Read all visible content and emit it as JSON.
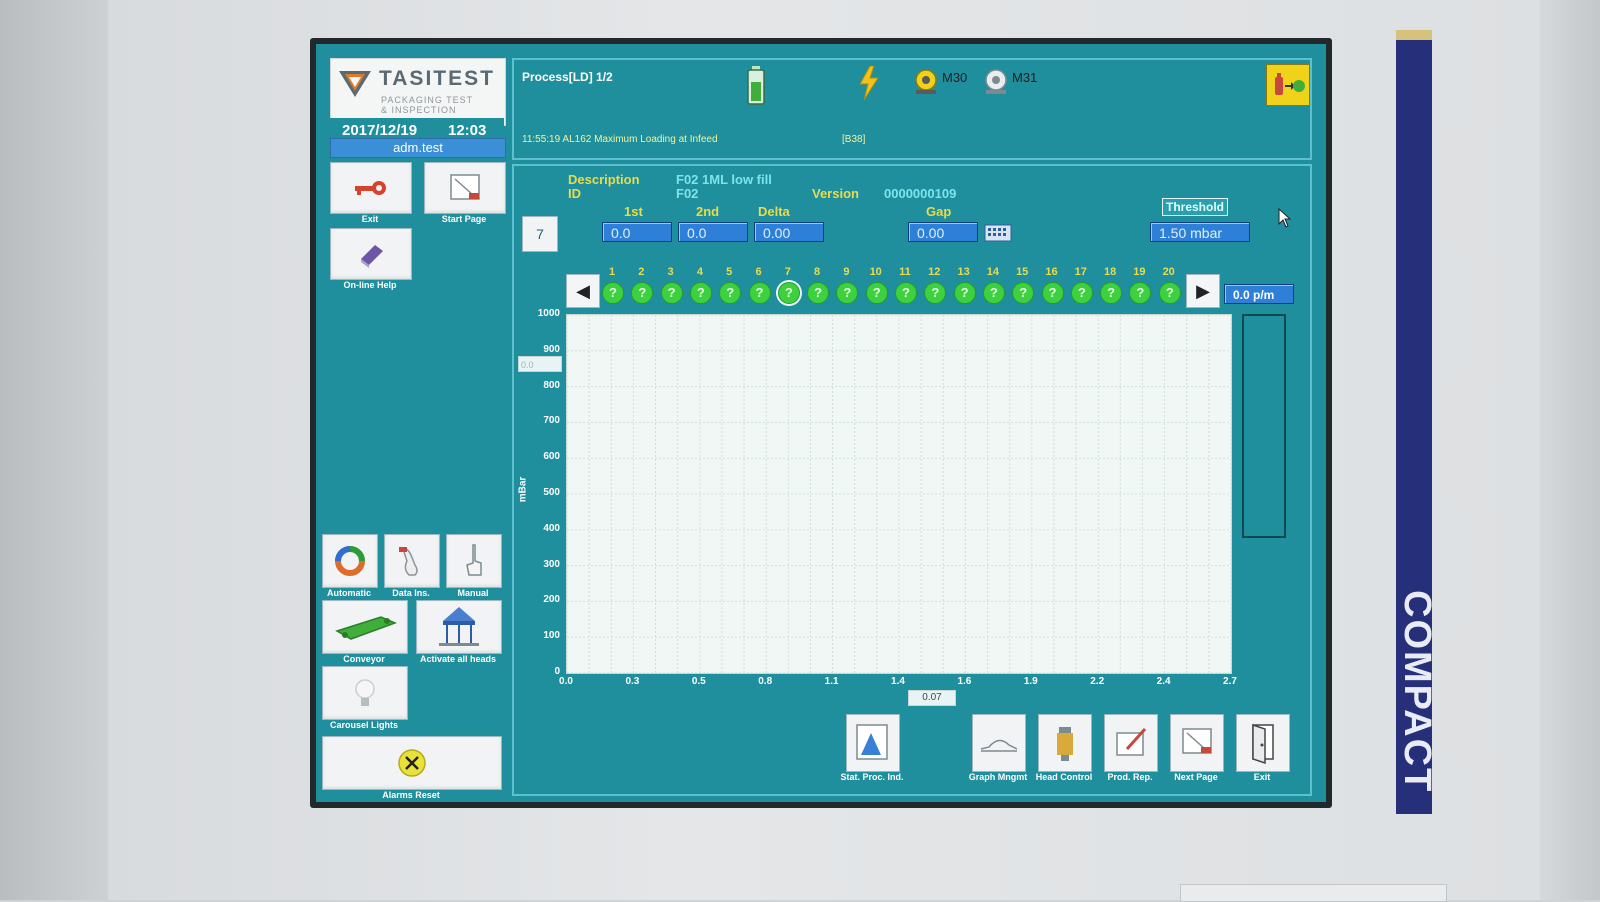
{
  "branding": {
    "logo_name": "TASITEST",
    "logo_sub_line1": "PACKAGING TEST",
    "logo_sub_line2": "& INSPECTION",
    "panel_brand": "COMPACT"
  },
  "session": {
    "date": "2017/12/19",
    "time": "12:03",
    "user": "adm.test"
  },
  "left_toolbar": {
    "exit": "Exit",
    "start_page": "Start Page",
    "online_help": "On-line Help",
    "automatic": "Automatic",
    "data_ins": "Data Ins.",
    "manual": "Manual",
    "conveyor": "Conveyor",
    "activate_all_heads": "Activate all heads",
    "carousel_lights": "Carousel Lights",
    "alarms_reset": "Alarms Reset"
  },
  "header": {
    "process": "Process[LD] 1/2",
    "m30": "M30",
    "m31": "M31",
    "alarm_message": "11:55:19 AL162 Maximum Loading at Infeed",
    "alarm_code": "[B38]"
  },
  "recipe": {
    "description_label": "Description",
    "description_value": "F02 1ML low fill",
    "id_label": "ID",
    "id_value": "F02",
    "version_label": "Version",
    "version_value": "0000000109"
  },
  "measures": {
    "head_selected": "7",
    "first_label": "1st",
    "first_value": "0.0",
    "second_label": "2nd",
    "second_value": "0.0",
    "delta_label": "Delta",
    "delta_value": "0.00",
    "gap_label": "Gap",
    "gap_value": "0.00",
    "threshold_label": "Threshold",
    "threshold_value": "1.50 mbar",
    "speed_value": "0.0 p/m"
  },
  "heads": {
    "selected": 7,
    "status_glyph": "?",
    "numbers": [
      "1",
      "2",
      "3",
      "4",
      "5",
      "6",
      "7",
      "8",
      "9",
      "10",
      "11",
      "12",
      "13",
      "14",
      "15",
      "16",
      "17",
      "18",
      "19",
      "20"
    ]
  },
  "chart_data": {
    "type": "line",
    "ylabel": "mBar",
    "ylim": [
      0,
      1000
    ],
    "y_ticks": [
      "0",
      "100",
      "200",
      "300",
      "400",
      "500",
      "600",
      "700",
      "800",
      "900",
      "1000"
    ],
    "x_ticks": [
      "0.0",
      "0.3",
      "0.5",
      "0.8",
      "1.1",
      "1.4",
      "1.6",
      "1.9",
      "2.2",
      "2.4",
      "2.7"
    ],
    "x_cursor": "0.07",
    "y_cursor": "0.0",
    "series": []
  },
  "bottom_toolbar": {
    "stat_proc_ind": "Stat. Proc. Ind.",
    "graph_mngmt": "Graph Mngmt",
    "head_control": "Head Control",
    "prod_rep": "Prod. Rep.",
    "next_page": "Next Page",
    "exit": "Exit"
  },
  "colors": {
    "screen_bg": "#1f8f9d",
    "field_blue": "#2e7fd8",
    "label_yellow": "#e9db4e",
    "head_ok_green": "#3dd13f",
    "brand_navy": "#26307a"
  }
}
